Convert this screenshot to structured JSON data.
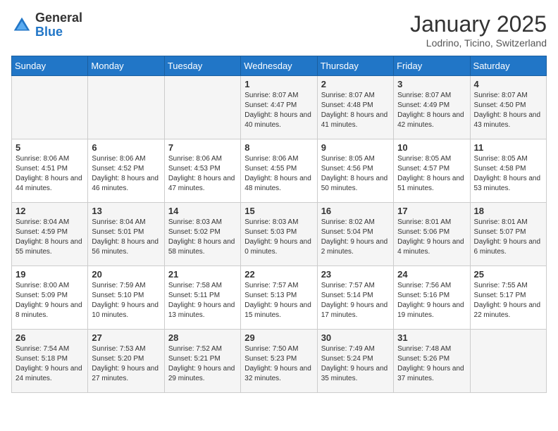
{
  "logo": {
    "general": "General",
    "blue": "Blue"
  },
  "title": "January 2025",
  "subtitle": "Lodrino, Ticino, Switzerland",
  "days_of_week": [
    "Sunday",
    "Monday",
    "Tuesday",
    "Wednesday",
    "Thursday",
    "Friday",
    "Saturday"
  ],
  "weeks": [
    [
      {
        "day": "",
        "info": ""
      },
      {
        "day": "",
        "info": ""
      },
      {
        "day": "",
        "info": ""
      },
      {
        "day": "1",
        "info": "Sunrise: 8:07 AM\nSunset: 4:47 PM\nDaylight: 8 hours and 40 minutes."
      },
      {
        "day": "2",
        "info": "Sunrise: 8:07 AM\nSunset: 4:48 PM\nDaylight: 8 hours and 41 minutes."
      },
      {
        "day": "3",
        "info": "Sunrise: 8:07 AM\nSunset: 4:49 PM\nDaylight: 8 hours and 42 minutes."
      },
      {
        "day": "4",
        "info": "Sunrise: 8:07 AM\nSunset: 4:50 PM\nDaylight: 8 hours and 43 minutes."
      }
    ],
    [
      {
        "day": "5",
        "info": "Sunrise: 8:06 AM\nSunset: 4:51 PM\nDaylight: 8 hours and 44 minutes."
      },
      {
        "day": "6",
        "info": "Sunrise: 8:06 AM\nSunset: 4:52 PM\nDaylight: 8 hours and 46 minutes."
      },
      {
        "day": "7",
        "info": "Sunrise: 8:06 AM\nSunset: 4:53 PM\nDaylight: 8 hours and 47 minutes."
      },
      {
        "day": "8",
        "info": "Sunrise: 8:06 AM\nSunset: 4:55 PM\nDaylight: 8 hours and 48 minutes."
      },
      {
        "day": "9",
        "info": "Sunrise: 8:05 AM\nSunset: 4:56 PM\nDaylight: 8 hours and 50 minutes."
      },
      {
        "day": "10",
        "info": "Sunrise: 8:05 AM\nSunset: 4:57 PM\nDaylight: 8 hours and 51 minutes."
      },
      {
        "day": "11",
        "info": "Sunrise: 8:05 AM\nSunset: 4:58 PM\nDaylight: 8 hours and 53 minutes."
      }
    ],
    [
      {
        "day": "12",
        "info": "Sunrise: 8:04 AM\nSunset: 4:59 PM\nDaylight: 8 hours and 55 minutes."
      },
      {
        "day": "13",
        "info": "Sunrise: 8:04 AM\nSunset: 5:01 PM\nDaylight: 8 hours and 56 minutes."
      },
      {
        "day": "14",
        "info": "Sunrise: 8:03 AM\nSunset: 5:02 PM\nDaylight: 8 hours and 58 minutes."
      },
      {
        "day": "15",
        "info": "Sunrise: 8:03 AM\nSunset: 5:03 PM\nDaylight: 9 hours and 0 minutes."
      },
      {
        "day": "16",
        "info": "Sunrise: 8:02 AM\nSunset: 5:04 PM\nDaylight: 9 hours and 2 minutes."
      },
      {
        "day": "17",
        "info": "Sunrise: 8:01 AM\nSunset: 5:06 PM\nDaylight: 9 hours and 4 minutes."
      },
      {
        "day": "18",
        "info": "Sunrise: 8:01 AM\nSunset: 5:07 PM\nDaylight: 9 hours and 6 minutes."
      }
    ],
    [
      {
        "day": "19",
        "info": "Sunrise: 8:00 AM\nSunset: 5:09 PM\nDaylight: 9 hours and 8 minutes."
      },
      {
        "day": "20",
        "info": "Sunrise: 7:59 AM\nSunset: 5:10 PM\nDaylight: 9 hours and 10 minutes."
      },
      {
        "day": "21",
        "info": "Sunrise: 7:58 AM\nSunset: 5:11 PM\nDaylight: 9 hours and 13 minutes."
      },
      {
        "day": "22",
        "info": "Sunrise: 7:57 AM\nSunset: 5:13 PM\nDaylight: 9 hours and 15 minutes."
      },
      {
        "day": "23",
        "info": "Sunrise: 7:57 AM\nSunset: 5:14 PM\nDaylight: 9 hours and 17 minutes."
      },
      {
        "day": "24",
        "info": "Sunrise: 7:56 AM\nSunset: 5:16 PM\nDaylight: 9 hours and 19 minutes."
      },
      {
        "day": "25",
        "info": "Sunrise: 7:55 AM\nSunset: 5:17 PM\nDaylight: 9 hours and 22 minutes."
      }
    ],
    [
      {
        "day": "26",
        "info": "Sunrise: 7:54 AM\nSunset: 5:18 PM\nDaylight: 9 hours and 24 minutes."
      },
      {
        "day": "27",
        "info": "Sunrise: 7:53 AM\nSunset: 5:20 PM\nDaylight: 9 hours and 27 minutes."
      },
      {
        "day": "28",
        "info": "Sunrise: 7:52 AM\nSunset: 5:21 PM\nDaylight: 9 hours and 29 minutes."
      },
      {
        "day": "29",
        "info": "Sunrise: 7:50 AM\nSunset: 5:23 PM\nDaylight: 9 hours and 32 minutes."
      },
      {
        "day": "30",
        "info": "Sunrise: 7:49 AM\nSunset: 5:24 PM\nDaylight: 9 hours and 35 minutes."
      },
      {
        "day": "31",
        "info": "Sunrise: 7:48 AM\nSunset: 5:26 PM\nDaylight: 9 hours and 37 minutes."
      },
      {
        "day": "",
        "info": ""
      }
    ]
  ]
}
